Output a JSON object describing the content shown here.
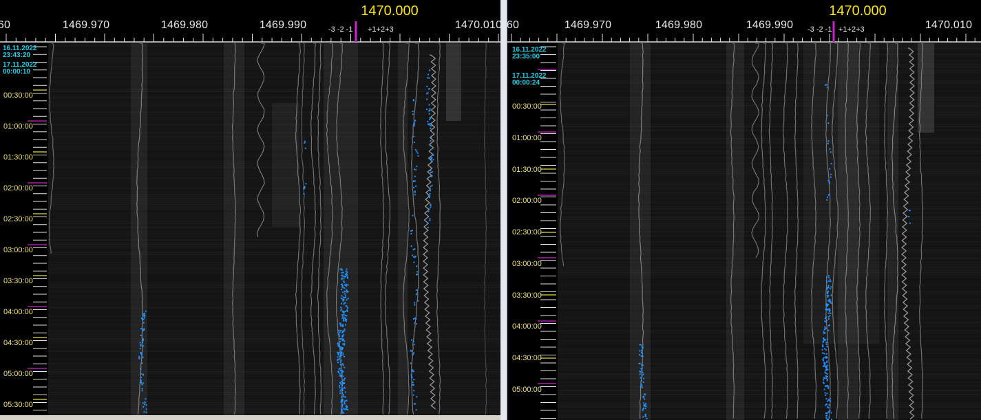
{
  "panes": [
    {
      "id": "left",
      "center_frequency": "1470.000",
      "frequency_labels": [
        "60",
        "1469.970",
        "1469.980",
        "1469.990",
        "1470.010"
      ],
      "offset_neg": "-3 -2 -1",
      "offset_pos": "+1+2+3",
      "start_stamp": {
        "date": "16.11.2022",
        "time": "23:43:20"
      },
      "second_stamp": {
        "date": "17.11.2022",
        "time": "00:00:10"
      },
      "time_labels": [
        "00:30:00",
        "01:00:00",
        "01:30:00",
        "02:00:00",
        "02:30:00",
        "03:00:00",
        "03:30:00",
        "04:00:00",
        "04:30:00",
        "05:00:00",
        "05:30:00"
      ]
    },
    {
      "id": "right",
      "center_frequency": "1470.000",
      "frequency_labels": [
        "60",
        "1469.970",
        "1469.980",
        "1469.990",
        "1470.010"
      ],
      "offset_neg": "-3 -2 -1",
      "offset_pos": "+1+2+3",
      "start_stamp": {
        "date": "16.11.2022",
        "time": "23:35:00"
      },
      "second_stamp": {
        "date": "17.11.2022",
        "time": "00:00:24"
      },
      "time_labels": [
        "00:30:00",
        "01:00:00",
        "01:30:00",
        "02:00:00",
        "02:30:00",
        "03:00:00",
        "03:30:00",
        "04:00:00",
        "04:30:00",
        "05:00:00"
      ]
    }
  ],
  "colors": {
    "center_marker": "#d21fd2",
    "frequency_text": "#e8e8e8",
    "center_text": "#ffe600",
    "timestamp_text": "#1fd0ea",
    "time_label_text": "#f2e36a",
    "signal_dots": "#1e90ff",
    "background": "#000000"
  }
}
